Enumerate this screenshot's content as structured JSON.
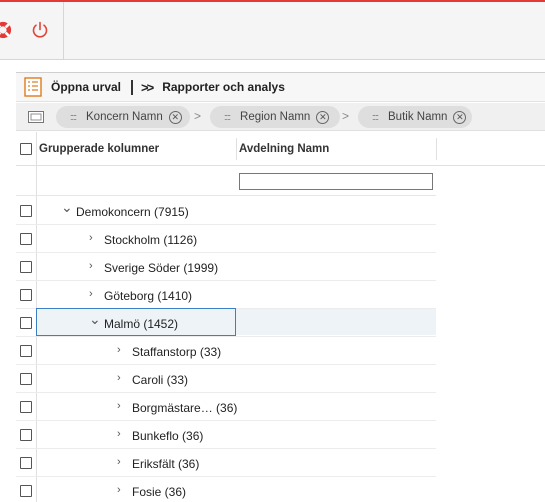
{
  "toolbar": {
    "open_label": "Öppna urval",
    "reports_label": "Rapporter och analys"
  },
  "group_panel": {
    "chips": [
      {
        "label": "Koncern Namn"
      },
      {
        "label": "Region Namn"
      },
      {
        "label": "Butik Namn"
      }
    ],
    "separator": ">"
  },
  "grid": {
    "columns": [
      "Grupperade kolumner",
      "Avdelning Namn"
    ],
    "filter_value": "",
    "rows": [
      {
        "label": "Demokoncern (7915)",
        "level": 0,
        "expanded": true
      },
      {
        "label": "Stockholm (1126)",
        "level": 1,
        "expanded": false
      },
      {
        "label": "Sverige Söder (1999)",
        "level": 1,
        "expanded": false
      },
      {
        "label": "Göteborg (1410)",
        "level": 1,
        "expanded": false
      },
      {
        "label": "Malmö (1452)",
        "level": 1,
        "expanded": true,
        "selected": true
      },
      {
        "label": "Staffanstorp (33)",
        "level": 2,
        "expanded": false
      },
      {
        "label": "Caroli (33)",
        "level": 2,
        "expanded": false
      },
      {
        "label": "Borgmästare… (36)",
        "level": 2,
        "expanded": false
      },
      {
        "label": "Bunkeflo (36)",
        "level": 2,
        "expanded": false
      },
      {
        "label": "Eriksfält (36)",
        "level": 2,
        "expanded": false
      },
      {
        "label": "Fosie (36)",
        "level": 2,
        "expanded": false
      }
    ]
  },
  "icons": {
    "help": "lifebuoy-icon",
    "logout": "power-icon",
    "open_selection": "list-icon",
    "group_panel": "group-panel-icon"
  },
  "colors": {
    "accent_red": "#e53935",
    "selection_border": "#3b7fc4",
    "power_icon": "#e0453a"
  }
}
